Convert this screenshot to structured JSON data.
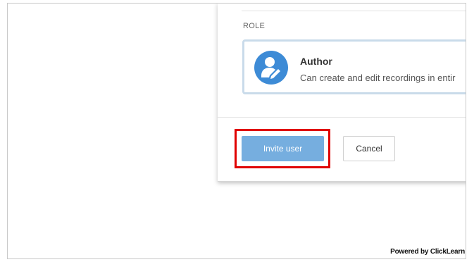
{
  "role_section": {
    "label": "ROLE",
    "selected_role": {
      "title": "Author",
      "description": "Can create and edit recordings in entir",
      "icon": "user-edit-icon",
      "icon_color": "#3d8bd6"
    }
  },
  "footer": {
    "invite_label": "Invite user",
    "cancel_label": "Cancel",
    "invite_color": "#76aedf",
    "highlight_color": "#e00000"
  },
  "watermark": {
    "text": "Powered by ClickLearn"
  }
}
